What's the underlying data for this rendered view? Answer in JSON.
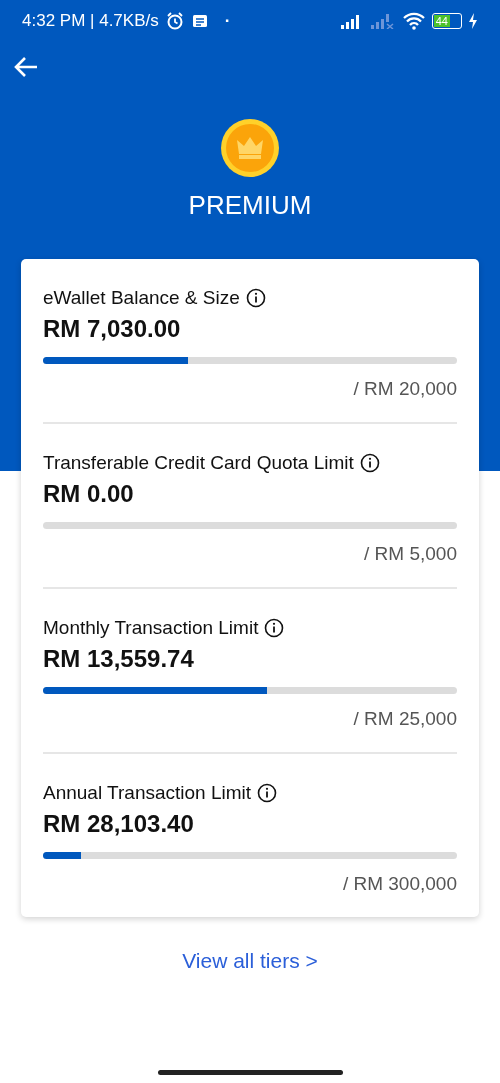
{
  "status_bar": {
    "time": "4:32 PM | 4.7KB/s",
    "dot": "·",
    "battery": "44"
  },
  "header": {
    "tier": "PREMIUM"
  },
  "limits": [
    {
      "title": "eWallet Balance & Size",
      "amount": "RM 7,030.00",
      "level": 0.35,
      "max": "/ RM 20,000"
    },
    {
      "title": "Transferable Credit Card Quota Limit",
      "amount": "RM 0.00",
      "max": "/ RM 5,000"
    },
    {
      "title": "Monthly Transaction Limit",
      "amount": "RM 13,559.74",
      "level": 0.54,
      "max": "/ RM 25,000"
    },
    {
      "title": "Annual Transaction Limit",
      "amount": "RM 28,103.40",
      "level": 0.092,
      "max": "/ RM 300,000"
    }
  ],
  "link": "View all tiers >"
}
